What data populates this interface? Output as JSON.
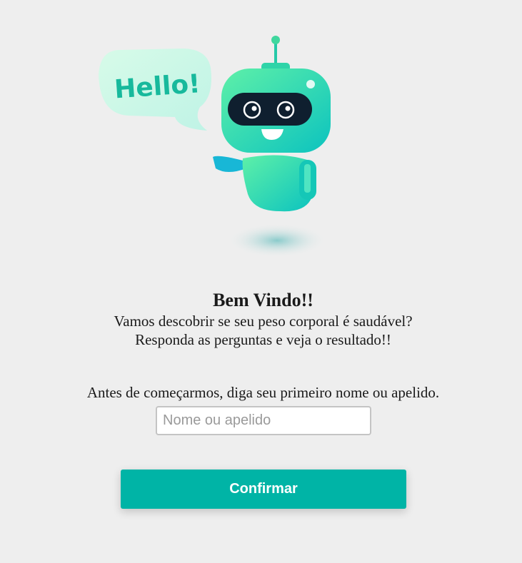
{
  "illustration": {
    "bubble_text": "Hello!",
    "icon": "robot-mascot-icon"
  },
  "welcome": {
    "title": "Bem Vindo!!",
    "line1": "Vamos descobrir se seu peso corporal é saudável?",
    "line2": "Responda as perguntas e veja o resultado!!"
  },
  "form": {
    "prompt": "Antes de começarmos, diga seu primeiro nome ou apelido.",
    "name_value": "",
    "name_placeholder": "Nome ou apelido",
    "confirm_label": "Confirmar"
  },
  "colors": {
    "background": "#eeeeee",
    "accent": "#00b4a6",
    "robot_top": "#4fe6b0",
    "robot_bottom": "#10c7b8"
  }
}
